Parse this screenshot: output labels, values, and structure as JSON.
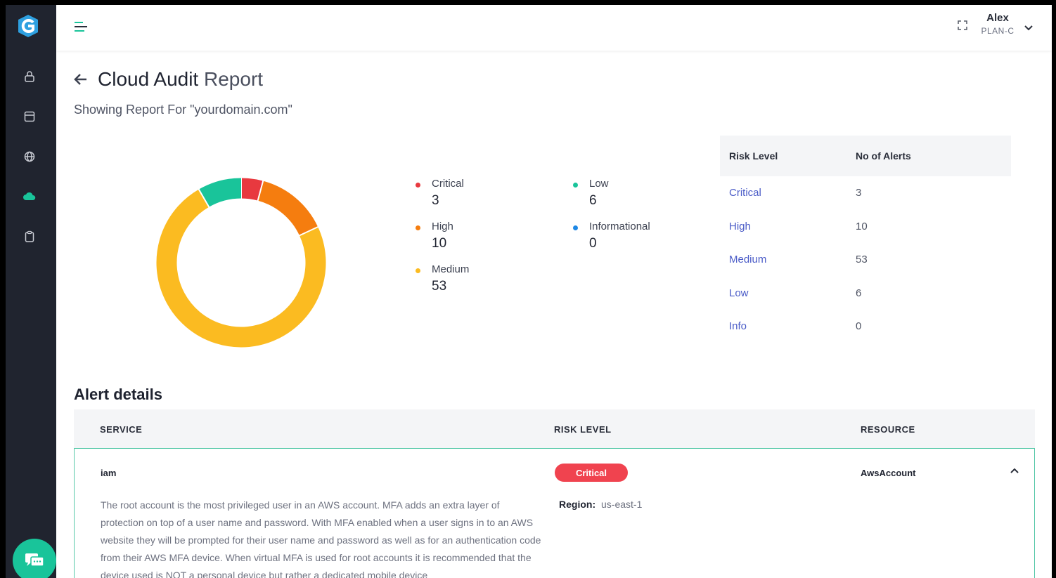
{
  "app": {
    "brand_letter": "G",
    "accent": "#19c49a"
  },
  "sidebar": {
    "items": [
      {
        "icon": "lock-icon"
      },
      {
        "icon": "browser-window-icon"
      },
      {
        "icon": "globe-icon"
      },
      {
        "icon": "cloud-icon"
      },
      {
        "icon": "clipboard-icon"
      }
    ],
    "chat_icon": "chat-icon"
  },
  "topbar": {
    "user_name": "Alex",
    "user_plan": "PLAN-C"
  },
  "header": {
    "title_main": "Cloud Audit",
    "title_accent": "Report",
    "subtitle": "Showing Report For \"yourdomain.com\""
  },
  "chart_data": {
    "type": "pie",
    "variant": "donut",
    "categories": [
      "Critical",
      "High",
      "Medium",
      "Low",
      "Informational"
    ],
    "values": [
      3,
      10,
      53,
      6,
      0
    ],
    "colors": [
      "#e8393f",
      "#f57d0f",
      "#fbbb21",
      "#19c49a",
      "#1e88e5"
    ]
  },
  "legend": [
    {
      "label": "Critical",
      "value": "3",
      "color": "#e8393f"
    },
    {
      "label": "High",
      "value": "10",
      "color": "#f57d0f"
    },
    {
      "label": "Medium",
      "value": "53",
      "color": "#fbbb21"
    },
    {
      "label": "Low",
      "value": "6",
      "color": "#19c49a"
    },
    {
      "label": "Informational",
      "value": "0",
      "color": "#1e88e5"
    }
  ],
  "risk_table": {
    "headers": [
      "Risk Level",
      "No of Alerts"
    ],
    "rows": [
      {
        "level": "Critical",
        "count": "3"
      },
      {
        "level": "High",
        "count": "10"
      },
      {
        "level": "Medium",
        "count": "53"
      },
      {
        "level": "Low",
        "count": "6"
      },
      {
        "level": "Info",
        "count": "0"
      }
    ]
  },
  "alerts": {
    "heading": "Alert details",
    "headers": {
      "service": "SERVICE",
      "risk_level": "RISK LEVEL",
      "resource": "RESOURCE"
    },
    "rows": [
      {
        "service": "iam",
        "risk": "Critical",
        "resource": "AwsAccount",
        "region_label": "Region:",
        "region_value": "us-east-1",
        "description": "The root account is the most privileged user in an AWS account. MFA adds an extra layer of protection on top of a user name and password. With MFA enabled when a user signs in to an AWS website they will be prompted for their user name and password as well as for an authentication code from their AWS MFA device. When virtual MFA is used for root accounts it is recommended that the device used is NOT a personal device but rather a dedicated mobile device"
      }
    ]
  }
}
